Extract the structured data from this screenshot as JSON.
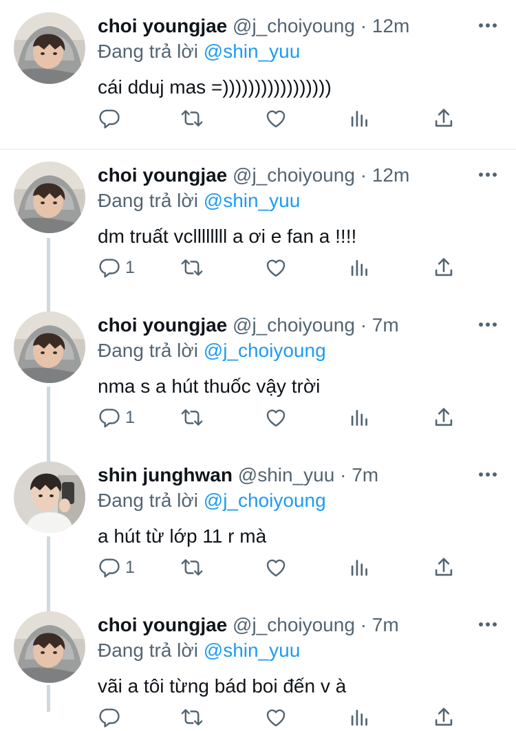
{
  "colors": {
    "link": "#1d9bf0",
    "muted": "#536471",
    "text": "#0f1419"
  },
  "reply_prefix": "Đang trả lời",
  "tweets": [
    {
      "name": "choi youngjae",
      "handle": "@j_choiyoung",
      "dot": "·",
      "time": "12m",
      "reply_to": "@shin_yuu",
      "text": "cái dduj mas =)))))))))))))))))",
      "reply_count": "",
      "avatar": "hoodie"
    },
    {
      "name": "choi youngjae",
      "handle": "@j_choiyoung",
      "dot": "·",
      "time": "12m",
      "reply_to": "@shin_yuu",
      "text": "dm truất vcllllllll a ơi e fan a !!!!",
      "reply_count": "1",
      "avatar": "hoodie"
    },
    {
      "name": "choi youngjae",
      "handle": "@j_choiyoung",
      "dot": "·",
      "time": "7m",
      "reply_to": "@j_choiyoung",
      "text": "nma s a hút thuốc vậy trời",
      "reply_count": "1",
      "avatar": "hoodie"
    },
    {
      "name": "shin junghwan",
      "handle": "@shin_yuu",
      "dot": "·",
      "time": "7m",
      "reply_to": "@j_choiyoung",
      "text": "a hút từ lớp 11 r mà",
      "reply_count": "1",
      "avatar": "selfie"
    },
    {
      "name": "choi youngjae",
      "handle": "@j_choiyoung",
      "dot": "·",
      "time": "7m",
      "reply_to": "@shin_yuu",
      "text": "vãi a tôi từng bád boi đến v à",
      "reply_count": "",
      "avatar": "hoodie"
    }
  ],
  "icons": [
    "reply-icon",
    "retweet-icon",
    "like-icon",
    "views-icon",
    "share-icon",
    "more-icon"
  ]
}
